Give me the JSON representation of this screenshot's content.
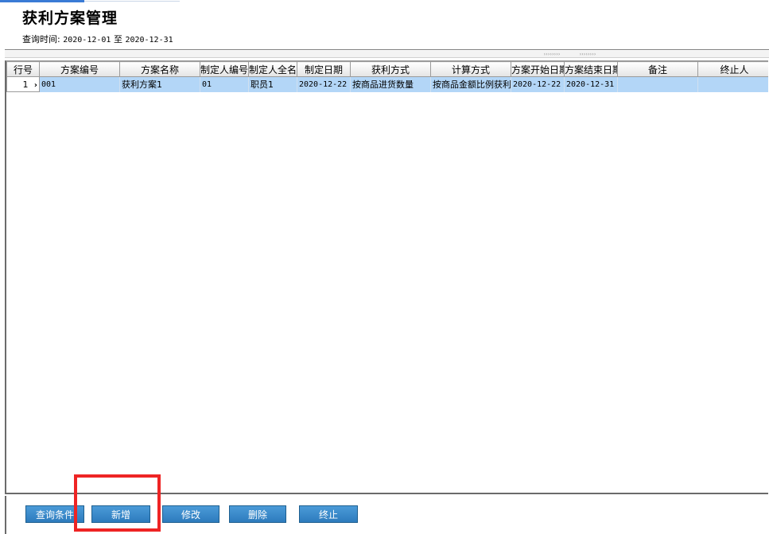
{
  "page": {
    "title": "获利方案管理",
    "query_label": "查询时间:",
    "date_from": "2020-12-01",
    "date_sep": "至",
    "date_to": "2020-12-31"
  },
  "splitter": {
    "grip_left": "››››››››",
    "grip_right": "››››››››"
  },
  "grid": {
    "columns": [
      "行号",
      "方案编号",
      "方案名称",
      "制定人编号",
      "制定人全名",
      "制定日期",
      "获利方式",
      "计算方式",
      "方案开始日期",
      "方案结束日期",
      "备注",
      "终止人"
    ],
    "rows": [
      {
        "row_no": "1",
        "marker": "›",
        "scheme_no": "001",
        "scheme_name": "获利方案1",
        "maker_no": "01",
        "maker_name": "职员1",
        "made_date": "2020-12-22",
        "profit_mode": "按商品进货数量",
        "calc_mode": "按商品金额比例获利",
        "start_date": "2020-12-22",
        "end_date": "2020-12-31",
        "remark": "",
        "terminator": ""
      }
    ]
  },
  "buttons": {
    "query": "查询条件",
    "add": "新增",
    "edit": "修改",
    "delete": "删除",
    "terminate": "终止"
  },
  "colors": {
    "selected_row": "#b3d6f7",
    "button": "#2d7bbd",
    "highlight": "#ee2424"
  }
}
